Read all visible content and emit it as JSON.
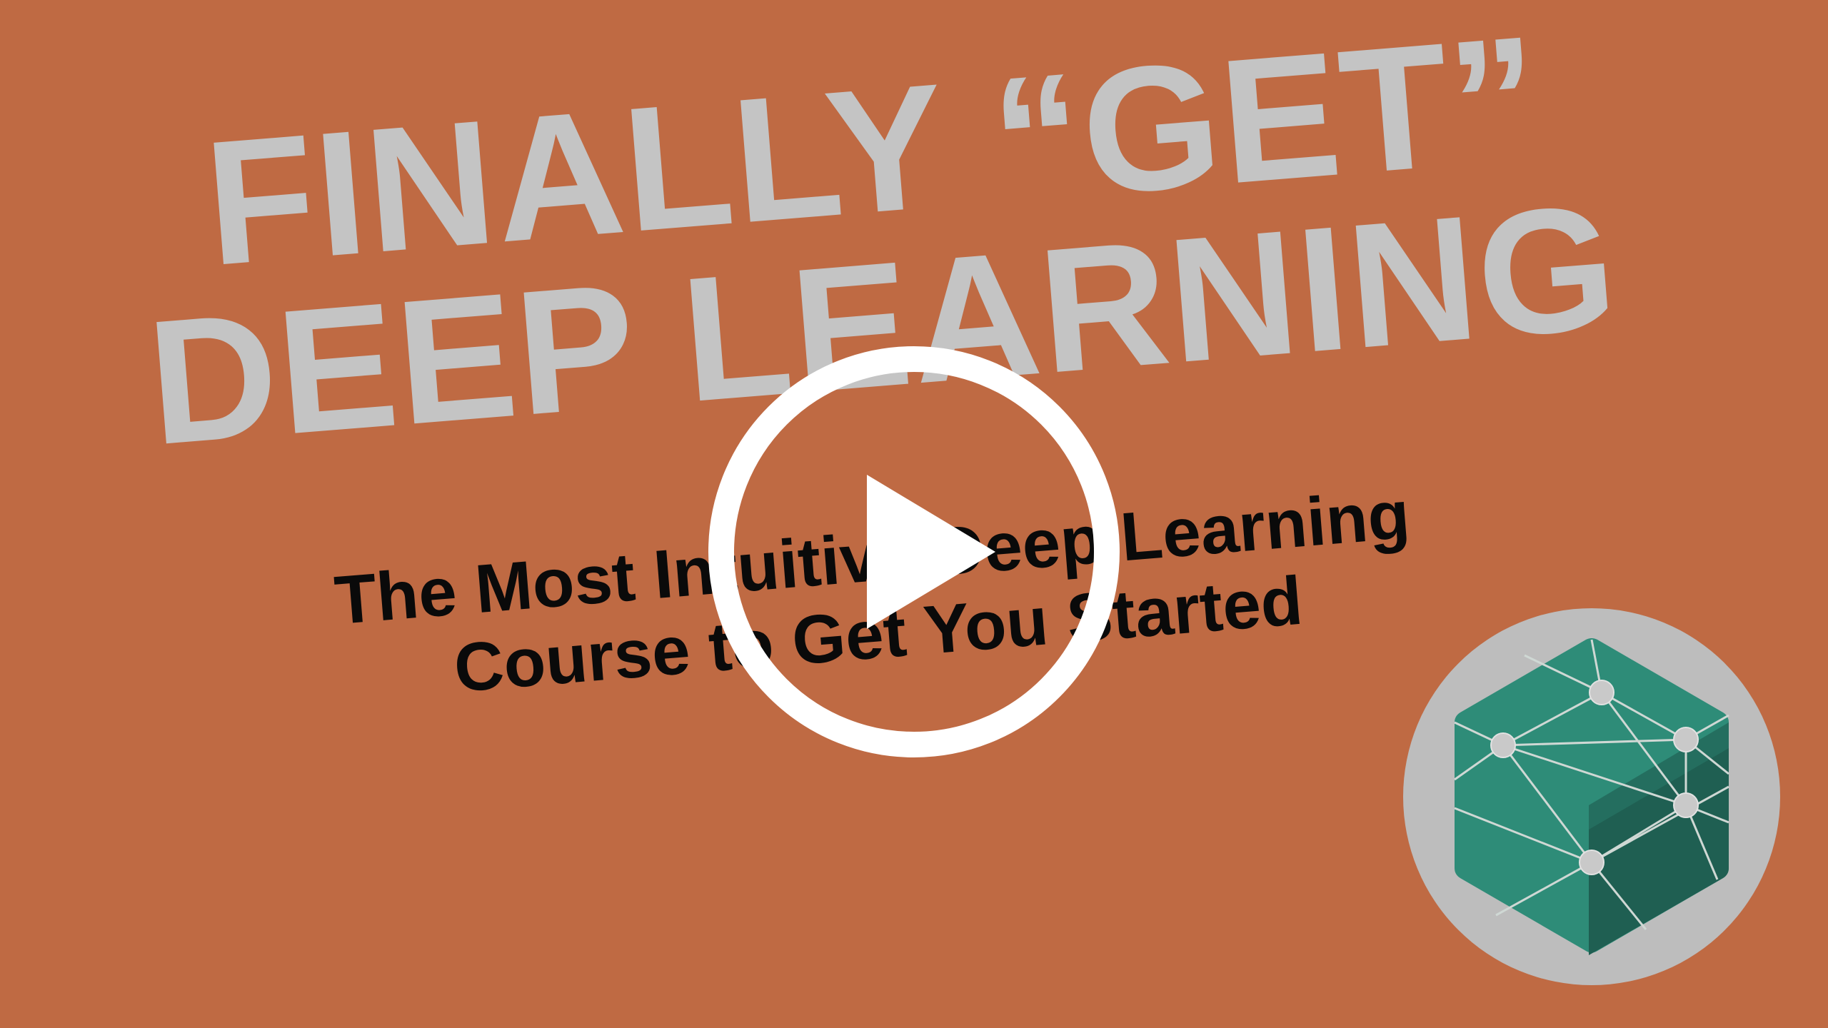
{
  "video": {
    "headline_line1": "FINALLY “GET”",
    "headline_line2": "DEEP LEARNING",
    "subtitle_line1": "The Most Intuitive Deep Learning",
    "subtitle_line2": "Course to Get You Started",
    "play_icon": "play-icon",
    "logo_icon": "hexagon-network-icon"
  },
  "colors": {
    "background": "#bf6a43",
    "headline": "#c4c4c4",
    "subtitle": "#0a0a0a",
    "play": "#ffffff",
    "logo_ring": "#bdbdbd",
    "logo_green": "#2e8c78",
    "logo_dark_green": "#1f5f52"
  }
}
